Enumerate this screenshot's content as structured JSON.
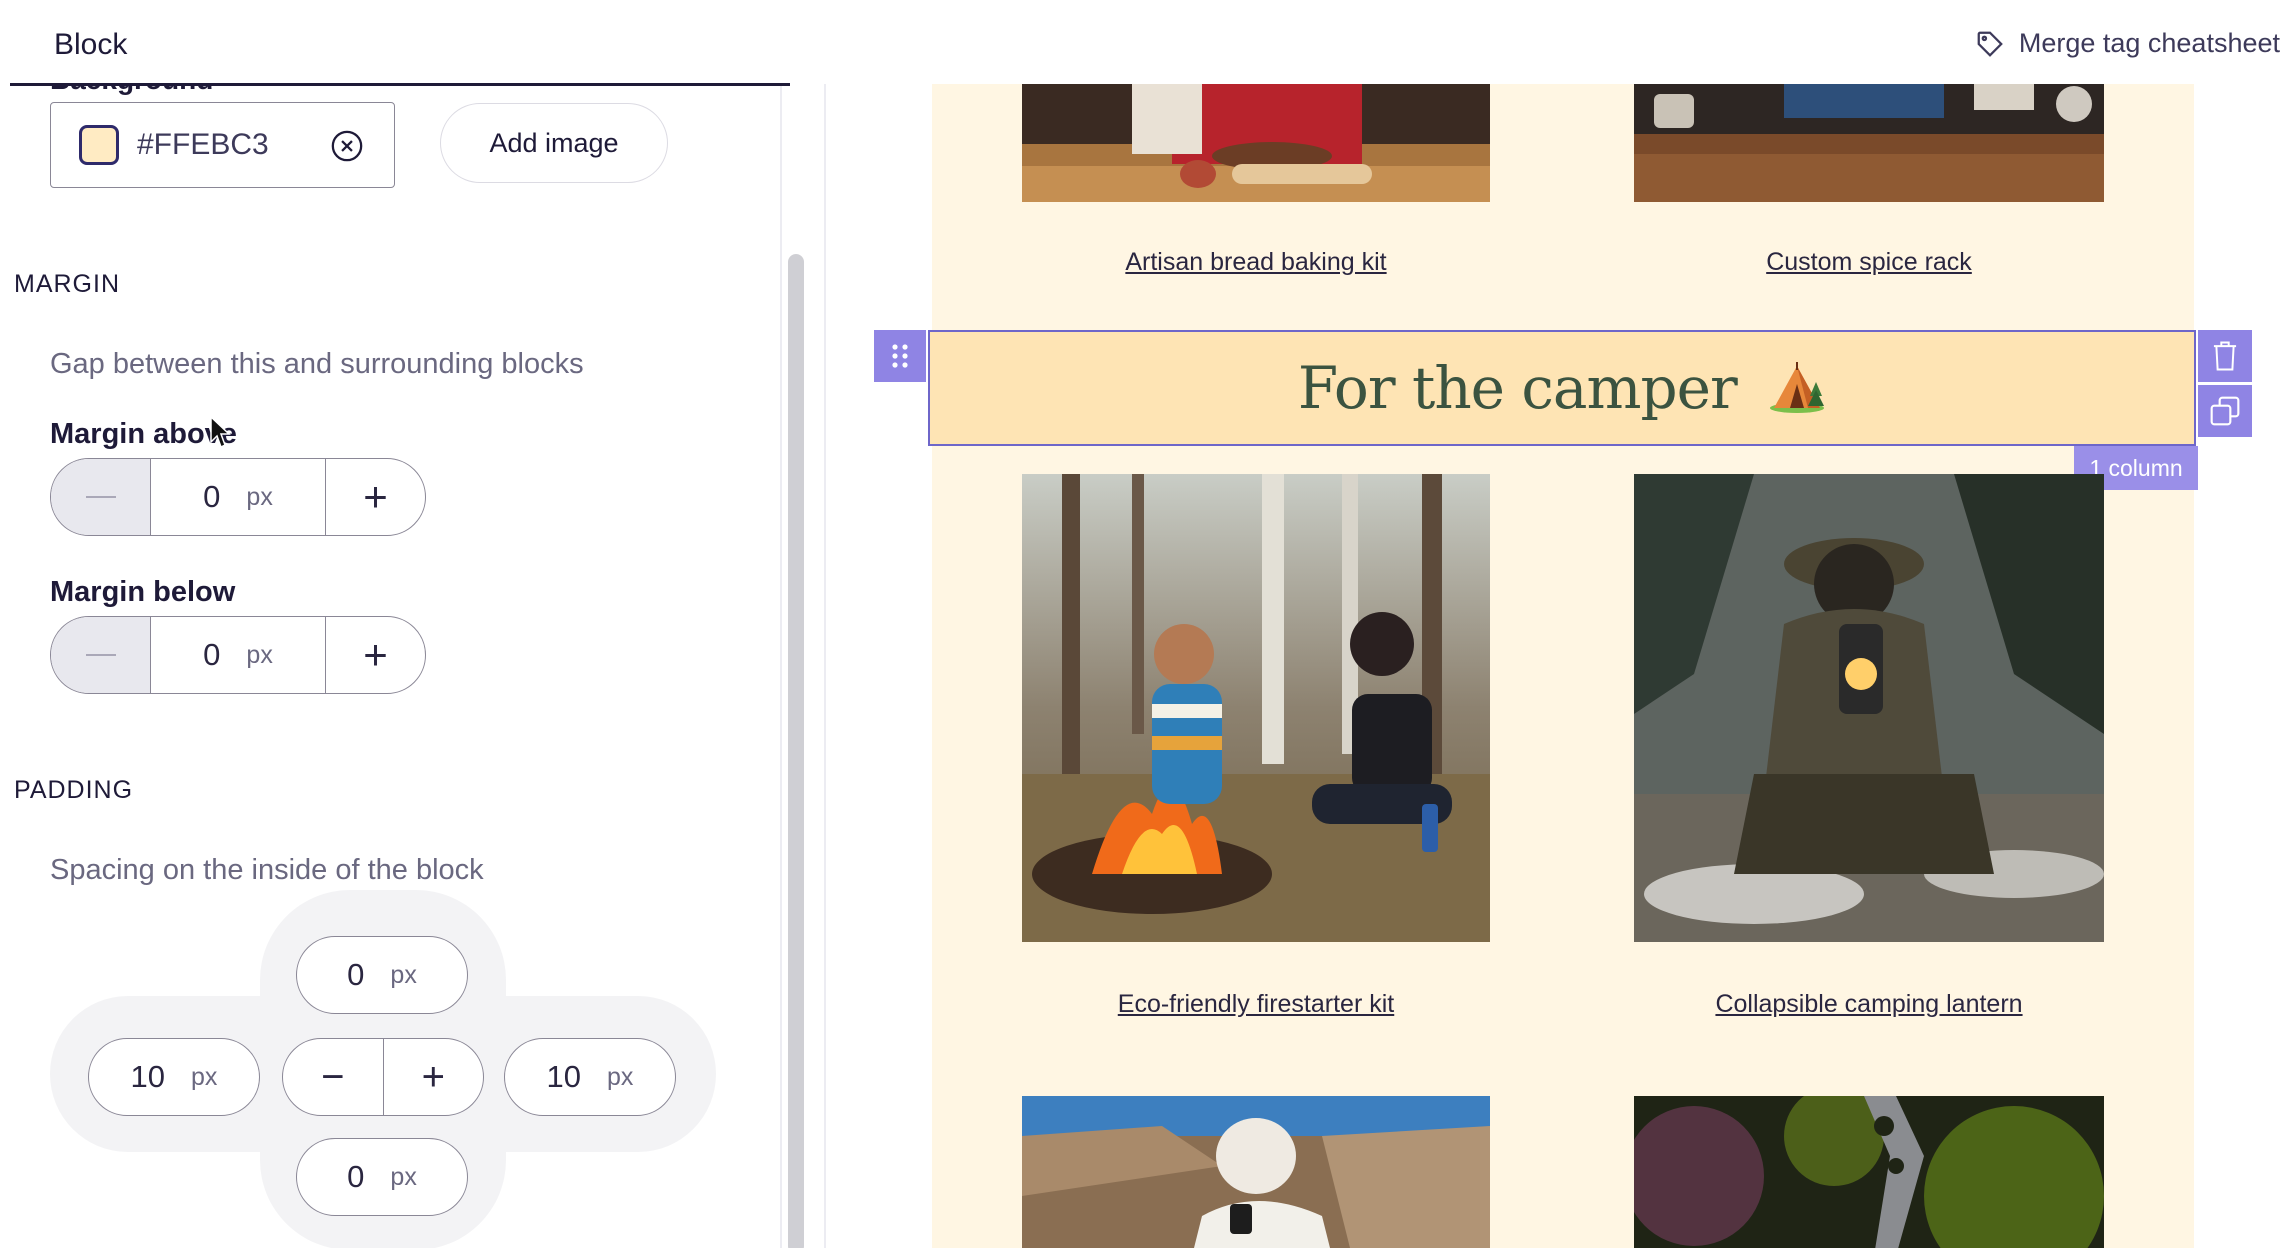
{
  "topbar": {
    "tab_label": "Block",
    "merge_link": "Merge tag cheatsheet"
  },
  "background": {
    "label": "Background",
    "color_value": "#FFEBC3",
    "swatch_color": "#FFEBC3",
    "add_image_label": "Add image"
  },
  "margin": {
    "title": "MARGIN",
    "description": "Gap between this and surrounding blocks",
    "above_label": "Margin above",
    "above_value": "0",
    "below_label": "Margin below",
    "below_value": "0",
    "unit": "px"
  },
  "padding": {
    "title": "PADDING",
    "description": "Spacing on the inside of the block",
    "top": "0",
    "left": "10",
    "right": "10",
    "bottom": "0",
    "unit": "px",
    "minus": "−",
    "plus": "+"
  },
  "canvas": {
    "products_top": [
      {
        "name": "Artisan bread baking kit"
      },
      {
        "name": "Custom spice rack"
      }
    ],
    "heading": "For the camper",
    "column_badge": "1 column",
    "products_middle": [
      {
        "name": "Eco-friendly firestarter kit"
      },
      {
        "name": "Collapsible camping lantern"
      }
    ]
  },
  "icons": {
    "tag": "tag-icon",
    "clear": "clear-circle-x-icon",
    "drag": "drag-grip-icon",
    "delete": "trash-icon",
    "duplicate": "duplicate-icon",
    "tent": "tent-emoji-icon"
  },
  "colors": {
    "accent": "#8F84E4",
    "email_bg": "#FFF6E3",
    "heading_bg": "#FEE4B4",
    "heading_text": "#3B5340"
  }
}
